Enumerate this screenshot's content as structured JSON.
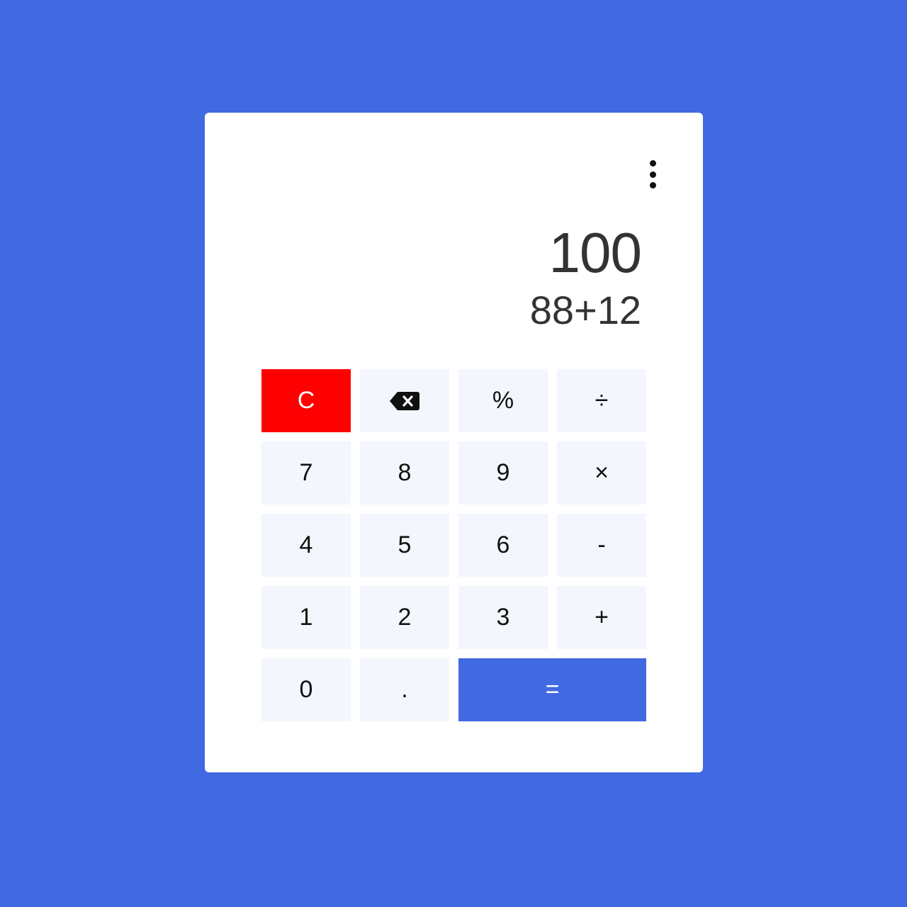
{
  "display": {
    "result": "100",
    "expression": "88+12"
  },
  "keys": {
    "clear": "C",
    "backspace_icon": "backspace-icon",
    "percent": "%",
    "divide": "÷",
    "seven": "7",
    "eight": "8",
    "nine": "9",
    "multiply": "×",
    "four": "4",
    "five": "5",
    "six": "6",
    "subtract": "-",
    "one": "1",
    "two": "2",
    "three": "3",
    "add": "+",
    "zero": "0",
    "decimal": ".",
    "equals": "="
  },
  "colors": {
    "background": "#4169e1",
    "clear_key": "#ff0000",
    "equals_key": "#4169e1",
    "key": "#f3f6fc"
  }
}
